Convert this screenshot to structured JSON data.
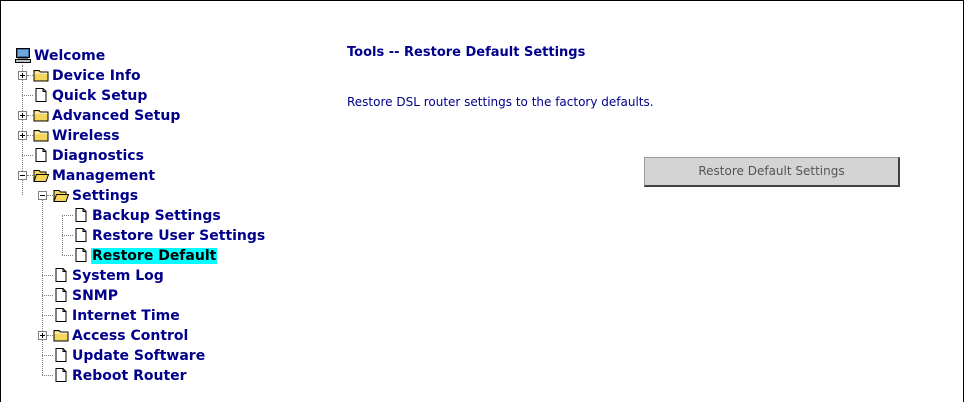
{
  "nav": {
    "welcome": "Welcome",
    "device_info": "Device Info",
    "quick_setup": "Quick Setup",
    "advanced_setup": "Advanced Setup",
    "wireless": "Wireless",
    "diagnostics": "Diagnostics",
    "management": "Management",
    "settings": "Settings",
    "backup_settings": "Backup Settings",
    "restore_user_settings": "Restore User Settings",
    "restore_default": "Restore Default",
    "system_log": "System Log",
    "snmp": "SNMP",
    "internet_time": "Internet Time",
    "access_control": "Access Control",
    "update_software": "Update Software",
    "reboot_router": "Reboot Router"
  },
  "main": {
    "title": "Tools -- Restore Default Settings",
    "description": "Restore DSL router settings to the factory defaults.",
    "restore_button_label": "Restore Default Settings"
  },
  "colors": {
    "link": "#00008b",
    "selected_bg": "#00ffff",
    "folder": "#f5d65a"
  }
}
